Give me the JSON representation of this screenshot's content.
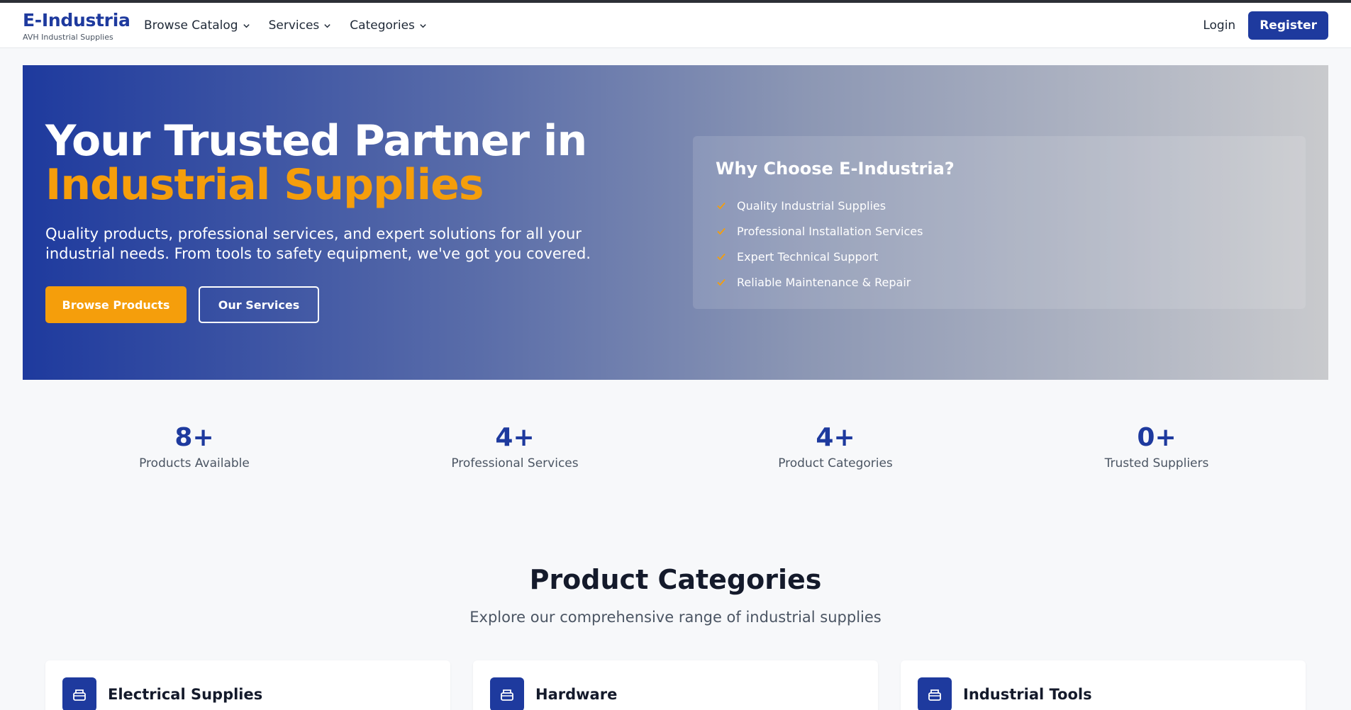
{
  "navbar": {
    "brand_name": "E-Industria",
    "brand_sub": "AVH Industrial Supplies",
    "menu": [
      {
        "label": "Browse Catalog"
      },
      {
        "label": "Services"
      },
      {
        "label": "Categories"
      }
    ],
    "login": "Login",
    "register": "Register"
  },
  "hero": {
    "title_line1": "Your Trusted Partner in",
    "title_line2": "Industrial Supplies",
    "description": "Quality products, professional services, and expert solutions for all your industrial needs. From tools to safety equipment, we've got you covered.",
    "primary_button": "Browse Products",
    "secondary_button": "Our Services",
    "why": {
      "title": "Why Choose E-Industria?",
      "items": [
        "Quality Industrial Supplies",
        "Professional Installation Services",
        "Expert Technical Support",
        "Reliable Maintenance & Repair"
      ]
    }
  },
  "stats": [
    {
      "value": "8+",
      "label": "Products Available"
    },
    {
      "value": "4+",
      "label": "Professional Services"
    },
    {
      "value": "4+",
      "label": "Product Categories"
    },
    {
      "value": "0+",
      "label": "Trusted Suppliers"
    }
  ],
  "categories": {
    "heading": "Product Categories",
    "subheading": "Explore our comprehensive range of industrial supplies",
    "items": [
      {
        "name": "Electrical Supplies",
        "icon": "box-icon"
      },
      {
        "name": "Hardware",
        "icon": "box-icon"
      },
      {
        "name": "Industrial Tools",
        "icon": "box-icon"
      }
    ]
  },
  "colors": {
    "primary": "#1e3a9e",
    "accent": "#f59e0b",
    "background": "#f7f8fa"
  }
}
